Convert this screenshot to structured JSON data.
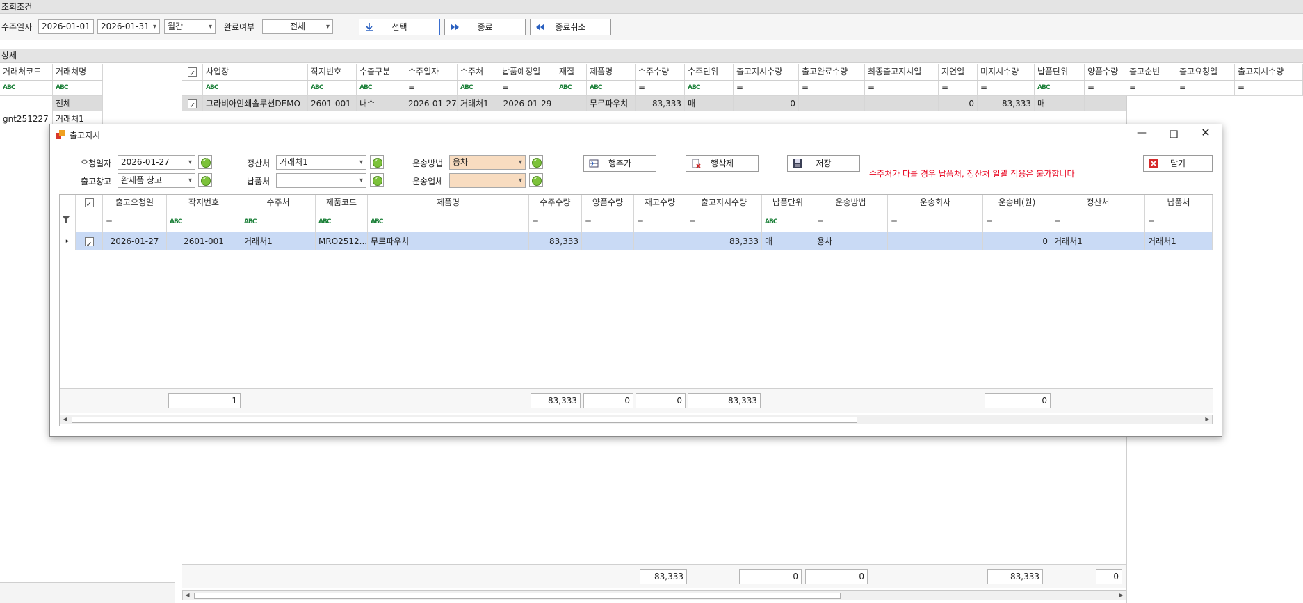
{
  "search": {
    "section_title": "조회조건",
    "order_date_label": "수주일자",
    "date_from": "2026-01-01",
    "date_to": "2026-01-31",
    "period": "월간",
    "complete_label": "완료여부",
    "complete_value": "전체",
    "select_btn": "선택",
    "close_btn": "종료",
    "cancel_close_btn": "종료취소"
  },
  "detail": {
    "section_title": "상세",
    "left_headers": [
      "거래처코드",
      "거래처명"
    ],
    "left_rows": [
      {
        "code": "",
        "name": "전체"
      },
      {
        "code": "gnt251227",
        "name": "거래처1"
      }
    ],
    "headers": [
      "사업장",
      "작지번호",
      "수출구분",
      "수주일자",
      "수주처",
      "납품예정일",
      "재질",
      "제품명",
      "수주수량",
      "수주단위",
      "출고지시수량",
      "출고완료수량",
      "최종출고지시일",
      "지연일",
      "미지시수량",
      "납품단위",
      "양품수량",
      "출고순번",
      "출고요청일",
      "출고지시수량"
    ],
    "row": {
      "site": "그라비아인쇄솔루션DEMO",
      "job_no": "2601-001",
      "export_type": "내수",
      "order_date": "2026-01-27",
      "customer": "거래처1",
      "delivery_date": "2026-01-29",
      "material": "",
      "product": "무로파우치",
      "order_qty": "83,333",
      "order_unit": "매",
      "ship_qty": "0",
      "done_qty": "",
      "last_date": "",
      "delay": "0",
      "unissued": "83,333",
      "unit": "매"
    },
    "totals": {
      "order_qty": "83,333",
      "ship_qty": "0",
      "done_qty": "0",
      "unissued": "83,333",
      "good": "0"
    }
  },
  "dialog": {
    "title": "출고지시",
    "req_date_label": "요청일자",
    "req_date": "2026-01-27",
    "warehouse_label": "출고창고",
    "warehouse": "완제품 창고",
    "settle_label": "정산처",
    "settle": "거래처1",
    "deliver_label": "납품처",
    "deliver": "",
    "method_label": "운송방법",
    "method": "용차",
    "carrier_label": "운송업체",
    "carrier": "",
    "add_row": "행추가",
    "del_row": "행삭제",
    "save": "저장",
    "close": "닫기",
    "warning": "수주처가 다를 경우 납품처, 정산처 일괄 적용은 불가합니다",
    "headers": [
      "출고요청일",
      "작지번호",
      "수주처",
      "제품코드",
      "제품명",
      "수주수량",
      "양품수량",
      "재고수량",
      "출고지시수량",
      "납품단위",
      "운송방법",
      "운송회사",
      "운송비(원)",
      "정산처",
      "납품처"
    ],
    "row": {
      "req_date": "2026-01-27",
      "job_no": "2601-001",
      "customer": "거래처1",
      "product_code": "MRO2512...",
      "product": "무로파우치",
      "order_qty": "83,333",
      "good_qty": "",
      "stock_qty": "",
      "ship_qty": "83,333",
      "unit": "매",
      "method": "용차",
      "carrier": "",
      "cost": "0",
      "settle": "거래처1",
      "deliver": "거래처1"
    },
    "totals": {
      "count": "1",
      "order_qty": "83,333",
      "good_qty": "0",
      "stock_qty": "0",
      "ship_qty": "83,333",
      "cost": "0"
    }
  },
  "colors": {
    "accent": "#f8dcc0",
    "selected_row": "#c9daf5",
    "warning": "#e8001c"
  }
}
